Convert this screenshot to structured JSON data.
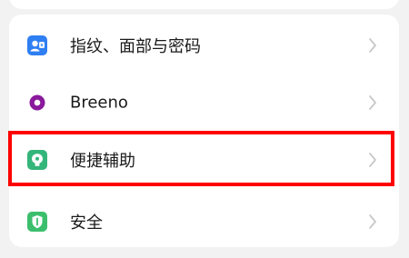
{
  "settings": {
    "items": [
      {
        "label": "指纹、面部与密码",
        "icon": "fingerprint-face-password-icon",
        "icon_color": "#2f7ff2"
      },
      {
        "label": "Breeno",
        "icon": "breeno-icon",
        "icon_color": "#8a1a9c"
      },
      {
        "label": "便捷辅助",
        "icon": "convenience-assist-icon",
        "icon_color": "#34b57a"
      },
      {
        "label": "安全",
        "icon": "security-shield-icon",
        "icon_color": "#3cbf6d"
      }
    ]
  },
  "colors": {
    "background": "#f2f2f2",
    "card": "#ffffff",
    "highlight_border": "#ff0000",
    "arrow": "#c8c8c8"
  }
}
